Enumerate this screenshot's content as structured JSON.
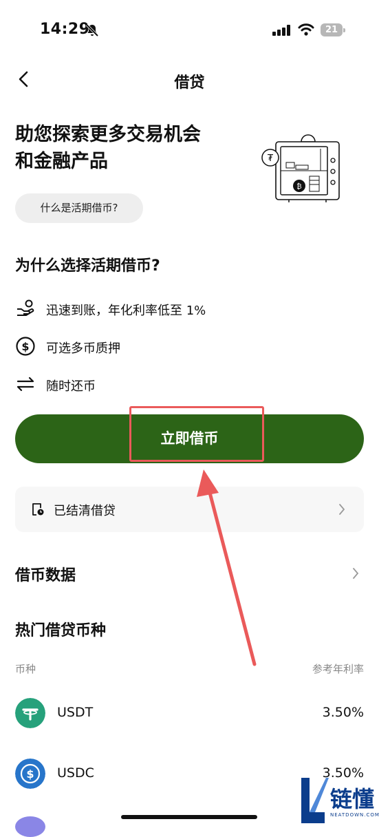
{
  "status": {
    "time": "14:29",
    "battery": "21"
  },
  "header": {
    "title": "借贷"
  },
  "hero": {
    "line1": "助您探索更多交易机会",
    "line2": "和金融产品"
  },
  "what_button": "什么是活期借币?",
  "why": {
    "title": "为什么选择活期借币?",
    "features": [
      {
        "icon": "hand-coin-icon",
        "text": "迅速到账，年化利率低至 1%"
      },
      {
        "icon": "dollar-circle-icon",
        "text": "可选多币质押"
      },
      {
        "icon": "swap-arrows-icon",
        "text": "随时还币"
      }
    ]
  },
  "cta": {
    "label": "立即借币"
  },
  "cleared": {
    "label": "已结清借贷"
  },
  "borrow_data": {
    "title": "借币数据"
  },
  "hot": {
    "title": "热门借贷币种",
    "col_coin": "币种",
    "col_rate": "参考年利率",
    "rows": [
      {
        "name": "USDT",
        "rate": "3.50%",
        "color": "#26a17b"
      },
      {
        "name": "USDC",
        "rate": "3.50%",
        "color": "#2775ca"
      }
    ]
  },
  "watermark": {
    "text": "链懂",
    "sub": "NEATDOWN.COM"
  },
  "colors": {
    "cta": "#2c6417",
    "highlight": "#ea5a5a",
    "arrow": "#ea5a5a"
  }
}
